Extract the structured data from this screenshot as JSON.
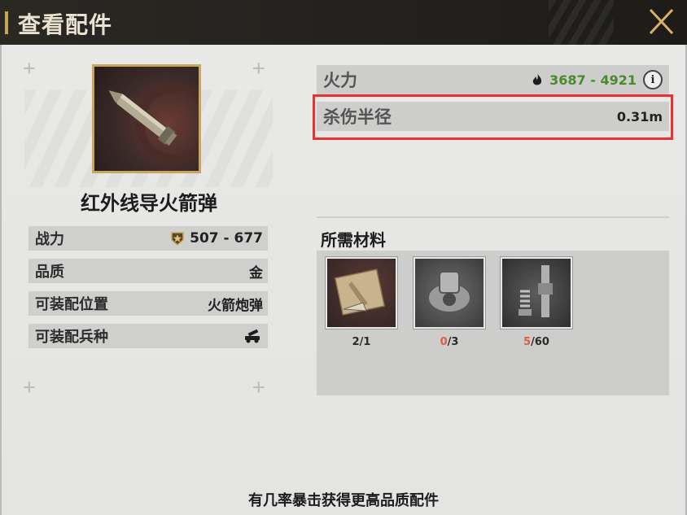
{
  "header": {
    "title": "查看配件",
    "close_icon": "close-x-icon"
  },
  "item": {
    "name": "红外线导火箭弹",
    "icon": "rocket-shell-icon",
    "frame_color": "#c9a55f"
  },
  "stats": [
    {
      "label": "战力",
      "value": "507 - 677",
      "icon": "rank-badge-icon"
    },
    {
      "label": "品质",
      "value": "金"
    },
    {
      "label": "可装配位置",
      "value": "火箭炮弹"
    },
    {
      "label": "可装配兵种",
      "value": "",
      "icon": "rocket-vehicle-icon"
    }
  ],
  "attributes": {
    "firepower": {
      "label": "火力",
      "value": "3687 - 4921",
      "icon": "flame-icon",
      "value_color": "#4a8a2a"
    },
    "kill_radius": {
      "label": "杀伤半径",
      "value": "0.31m"
    },
    "info_icon": "info-icon",
    "highlight_color": "#e8322f"
  },
  "materials": {
    "title": "所需材料",
    "items": [
      {
        "icon": "blueprint-icon",
        "have": "2",
        "need": "1",
        "insufficient": false
      },
      {
        "icon": "gear-differential-icon",
        "have": "0",
        "need": "3",
        "insufficient": true
      },
      {
        "icon": "spring-bolt-icon",
        "have": "5",
        "need": "60",
        "insufficient": true
      }
    ],
    "shortage_color": "#e05a4a"
  },
  "footer": {
    "text": "有几率暴击获得更高品质配件"
  }
}
